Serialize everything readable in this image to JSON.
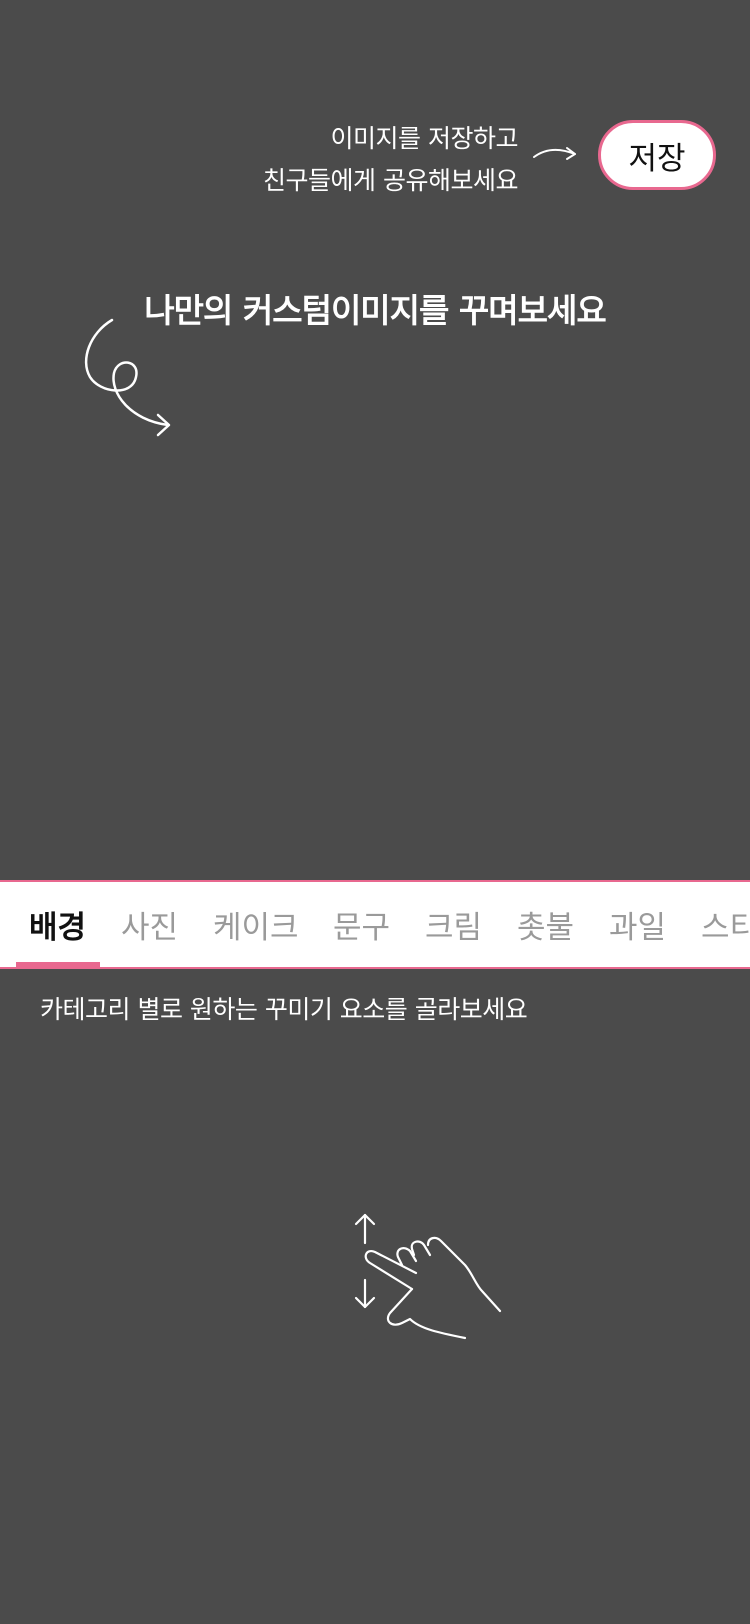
{
  "header": {
    "save_hint_line1": "이미지를 저장하고",
    "save_hint_line2": "친구들에게 공유해보세요",
    "save_label": "저장",
    "arrow_icon": "arrow-right-icon"
  },
  "main": {
    "title": "나만의 커스텀이미지를 꾸며보세요",
    "curl_icon": "curly-arrow-icon"
  },
  "categories": {
    "tabs": [
      {
        "label": "배경",
        "active": true
      },
      {
        "label": "사진",
        "active": false
      },
      {
        "label": "케이크",
        "active": false
      },
      {
        "label": "문구",
        "active": false
      },
      {
        "label": "크림",
        "active": false
      },
      {
        "label": "촛불",
        "active": false
      },
      {
        "label": "과일",
        "active": false
      },
      {
        "label": "스티",
        "active": false
      }
    ],
    "hint": "카테고리 별로 원하는 꾸미기 요소를 골라보세요",
    "swipe_icon": "hand-swipe-icon"
  },
  "colors": {
    "background": "#4b4b4b",
    "accent": "#e8688f",
    "text_light": "#ffffff",
    "tab_inactive": "#9a9a9a",
    "tab_active": "#111111"
  }
}
